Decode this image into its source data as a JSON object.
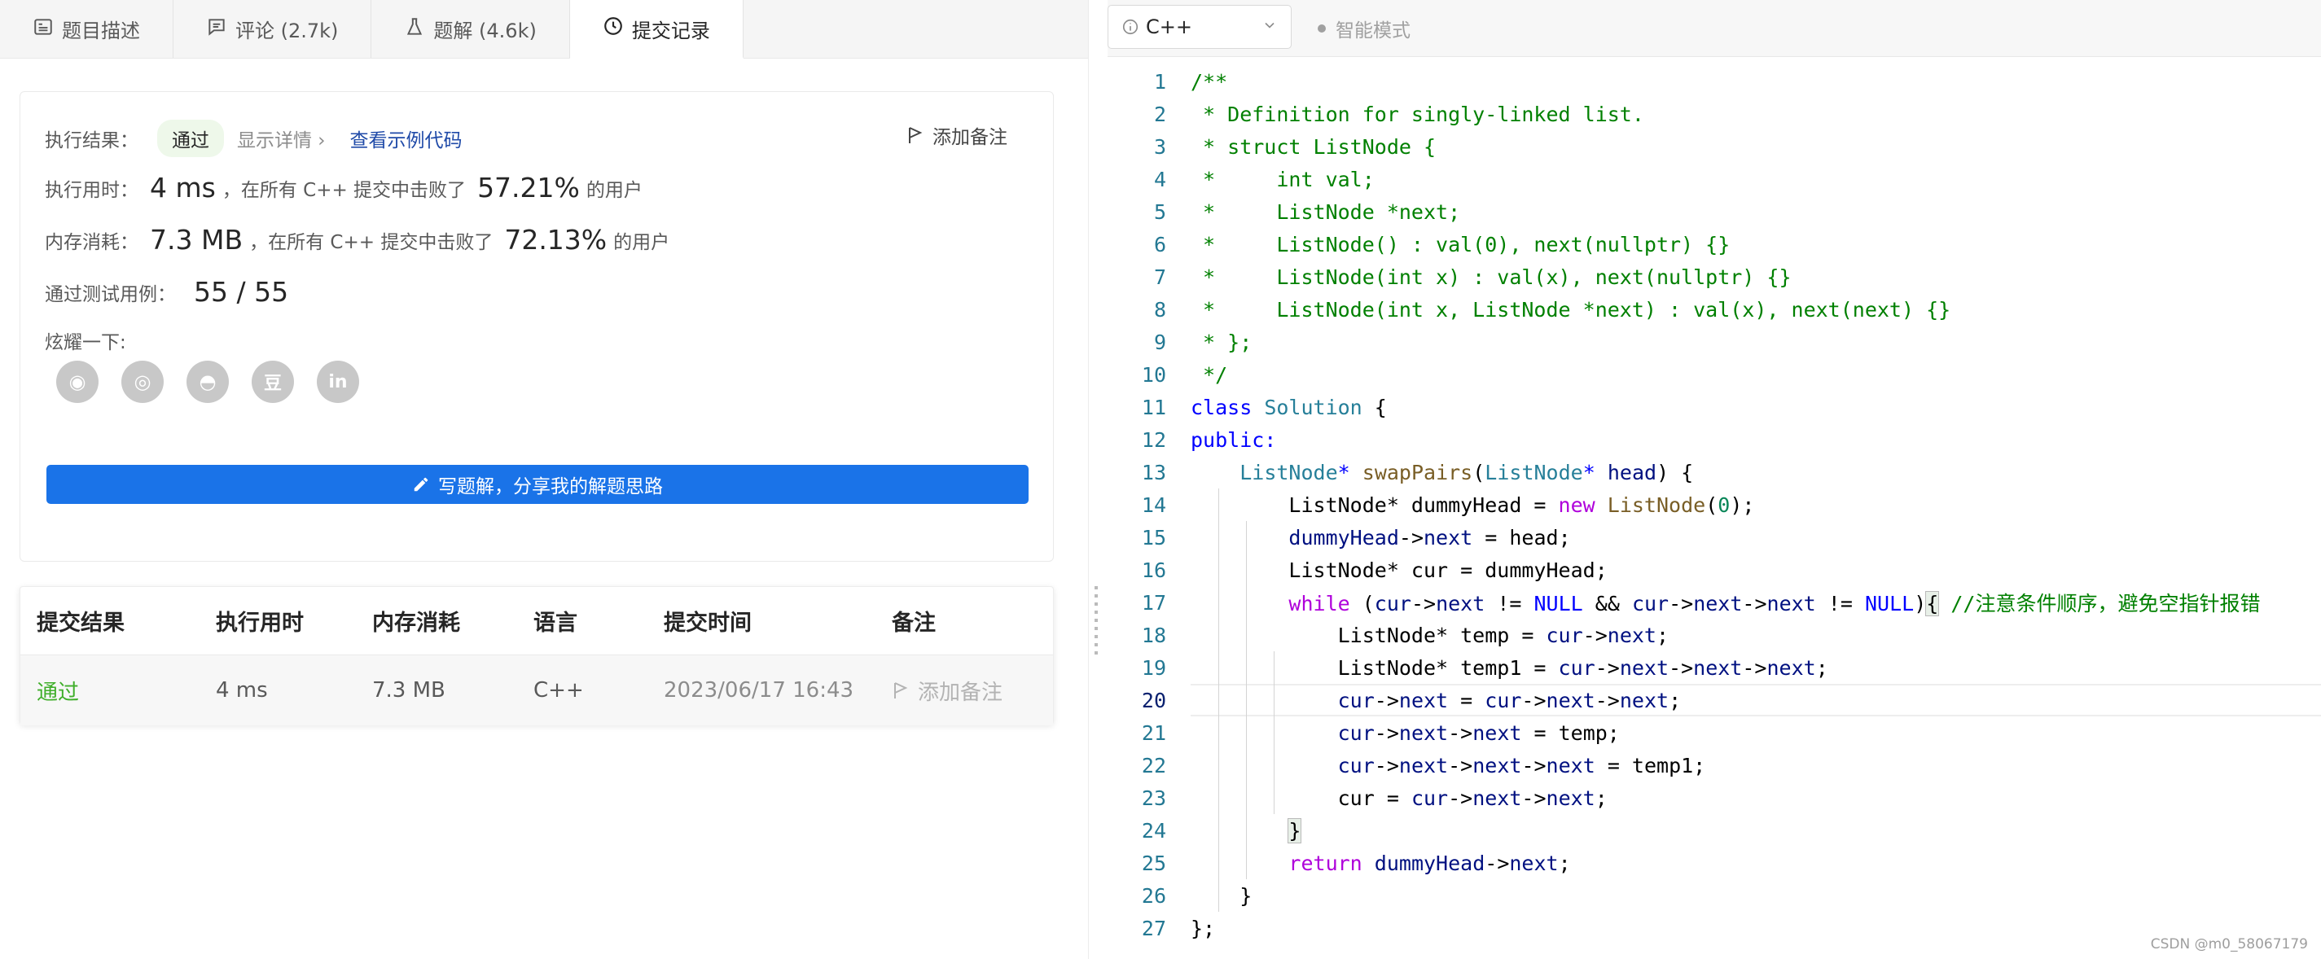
{
  "tabs": [
    {
      "label": "题目描述",
      "icon": "description-icon"
    },
    {
      "label": "评论 (2.7k)",
      "icon": "comment-icon"
    },
    {
      "label": "题解 (4.6k)",
      "icon": "flask-icon"
    },
    {
      "label": "提交记录",
      "icon": "clock-icon"
    }
  ],
  "result": {
    "label": "执行结果：",
    "status": "通过",
    "details": "显示详情 ›",
    "sample_link": "查看示例代码",
    "add_note": "添加备注",
    "runtime_label": "执行用时：",
    "runtime_value": "4 ms",
    "runtime_text": "，在所有 C++ 提交中击败了",
    "runtime_pct": "57.21%",
    "users": "的用户",
    "memory_label": "内存消耗：",
    "memory_value": "7.3 MB",
    "memory_text": "，在所有 C++ 提交中击败了",
    "memory_pct": "72.13%",
    "memory_users": "的用户",
    "tests_label": "通过测试用例：",
    "tests_value": "55 / 55",
    "share_label": "炫耀一下:",
    "share_icons": [
      {
        "name": "wechat-icon",
        "glyph": "◉"
      },
      {
        "name": "weibo-icon",
        "glyph": "◎"
      },
      {
        "name": "qq-icon",
        "glyph": "◓"
      },
      {
        "name": "douban-icon",
        "glyph": "豆"
      },
      {
        "name": "linkedin-icon",
        "glyph": "in"
      }
    ],
    "write_button": "写题解，分享我的解题思路"
  },
  "submissions": {
    "headers": [
      "提交结果",
      "执行用时",
      "内存消耗",
      "语言",
      "提交时间",
      "备注"
    ],
    "rows": [
      {
        "result": "通过",
        "runtime": "4 ms",
        "memory": "7.3 MB",
        "lang": "C++",
        "time": "2023/06/17 16:43",
        "note": "添加备注"
      }
    ]
  },
  "editor": {
    "language": "C++",
    "smart_mode": "智能模式",
    "current_line": 20,
    "colors": {
      "comment": "#008000",
      "keyword": "#0000ff",
      "control": "#af00db",
      "type": "#267f99"
    }
  },
  "code_lines": [
    [
      [
        "/**",
        "com"
      ]
    ],
    [
      [
        " * Definition for singly-linked list.",
        "com"
      ]
    ],
    [
      [
        " * struct ListNode {",
        "com"
      ]
    ],
    [
      [
        " *     int val;",
        "com"
      ]
    ],
    [
      [
        " *     ListNode *next;",
        "com"
      ]
    ],
    [
      [
        " *     ListNode() : val(0), next(nullptr) {}",
        "com"
      ]
    ],
    [
      [
        " *     ListNode(int x) : val(x), next(nullptr) {}",
        "com"
      ]
    ],
    [
      [
        " *     ListNode(int x, ListNode *next) : val(x), next(next) {}",
        "com"
      ]
    ],
    [
      [
        " * };",
        "com"
      ]
    ],
    [
      [
        " */",
        "com"
      ]
    ],
    [
      [
        "class",
        "kw"
      ],
      [
        " ",
        ""
      ],
      [
        "Solution",
        "type"
      ],
      [
        " {",
        ""
      ]
    ],
    [
      [
        "public:",
        "kw"
      ]
    ],
    [
      [
        "    ",
        ""
      ],
      [
        "ListNode",
        "type"
      ],
      [
        "*",
        "kw"
      ],
      [
        " ",
        ""
      ],
      [
        "swapPairs",
        "fn"
      ],
      [
        "(",
        ""
      ],
      [
        "ListNode",
        "type"
      ],
      [
        "*",
        "kw"
      ],
      [
        " ",
        ""
      ],
      [
        "head",
        "var"
      ],
      [
        ") {",
        ""
      ]
    ],
    [
      [
        "        ListNode* dummyHead = ",
        ""
      ],
      [
        "new",
        "kw2"
      ],
      [
        " ",
        ""
      ],
      [
        "ListNode",
        "fn"
      ],
      [
        "(",
        ""
      ],
      [
        "0",
        "num"
      ],
      [
        ");",
        ""
      ]
    ],
    [
      [
        "        ",
        ""
      ],
      [
        "dummyHead",
        "var"
      ],
      [
        "->",
        ""
      ],
      [
        "next",
        "var"
      ],
      [
        " = head;",
        ""
      ]
    ],
    [
      [
        "        ListNode* cur = dummyHead;",
        ""
      ]
    ],
    [
      [
        "        ",
        ""
      ],
      [
        "while",
        "kw2"
      ],
      [
        " (",
        ""
      ],
      [
        "cur",
        "var"
      ],
      [
        "->",
        ""
      ],
      [
        "next",
        "var"
      ],
      [
        " != ",
        ""
      ],
      [
        "NULL",
        "const"
      ],
      [
        " && ",
        ""
      ],
      [
        "cur",
        "var"
      ],
      [
        "->",
        ""
      ],
      [
        "next",
        "var"
      ],
      [
        "->",
        ""
      ],
      [
        "next",
        "var"
      ],
      [
        " != ",
        ""
      ],
      [
        "NULL",
        "const"
      ],
      [
        ")",
        ""
      ],
      [
        "{",
        "box"
      ],
      [
        " ",
        ""
      ],
      [
        "//注意条件顺序，避免空指针报错",
        "com"
      ]
    ],
    [
      [
        "            ListNode* temp = ",
        ""
      ],
      [
        "cur",
        "var"
      ],
      [
        "->",
        ""
      ],
      [
        "next",
        "var"
      ],
      [
        ";",
        ""
      ]
    ],
    [
      [
        "            ListNode* temp1 = ",
        ""
      ],
      [
        "cur",
        "var"
      ],
      [
        "->",
        ""
      ],
      [
        "next",
        "var"
      ],
      [
        "->",
        ""
      ],
      [
        "next",
        "var"
      ],
      [
        "->",
        ""
      ],
      [
        "next",
        "var"
      ],
      [
        ";",
        ""
      ]
    ],
    [
      [
        "            ",
        ""
      ],
      [
        "cur",
        "var"
      ],
      [
        "->",
        ""
      ],
      [
        "next",
        "var"
      ],
      [
        " = ",
        ""
      ],
      [
        "cur",
        "var"
      ],
      [
        "->",
        ""
      ],
      [
        "next",
        "var"
      ],
      [
        "->",
        ""
      ],
      [
        "next",
        "var"
      ],
      [
        ";",
        ""
      ]
    ],
    [
      [
        "            ",
        ""
      ],
      [
        "cur",
        "var"
      ],
      [
        "->",
        ""
      ],
      [
        "next",
        "var"
      ],
      [
        "->",
        ""
      ],
      [
        "next",
        "var"
      ],
      [
        " = temp;",
        ""
      ]
    ],
    [
      [
        "            ",
        ""
      ],
      [
        "cur",
        "var"
      ],
      [
        "->",
        ""
      ],
      [
        "next",
        "var"
      ],
      [
        "->",
        ""
      ],
      [
        "next",
        "var"
      ],
      [
        "->",
        ""
      ],
      [
        "next",
        "var"
      ],
      [
        " = temp1;",
        ""
      ]
    ],
    [
      [
        "            cur = ",
        ""
      ],
      [
        "cur",
        "var"
      ],
      [
        "->",
        ""
      ],
      [
        "next",
        "var"
      ],
      [
        "->",
        ""
      ],
      [
        "next",
        "var"
      ],
      [
        ";",
        ""
      ]
    ],
    [
      [
        "        ",
        ""
      ],
      [
        "}",
        "box"
      ]
    ],
    [
      [
        "        ",
        ""
      ],
      [
        "return",
        "kw2"
      ],
      [
        " ",
        ""
      ],
      [
        "dummyHead",
        "var"
      ],
      [
        "->",
        ""
      ],
      [
        "next",
        "var"
      ],
      [
        ";",
        ""
      ]
    ],
    [
      [
        "    }",
        ""
      ]
    ],
    [
      [
        "};",
        ""
      ]
    ]
  ],
  "watermark": "CSDN @m0_58067179"
}
